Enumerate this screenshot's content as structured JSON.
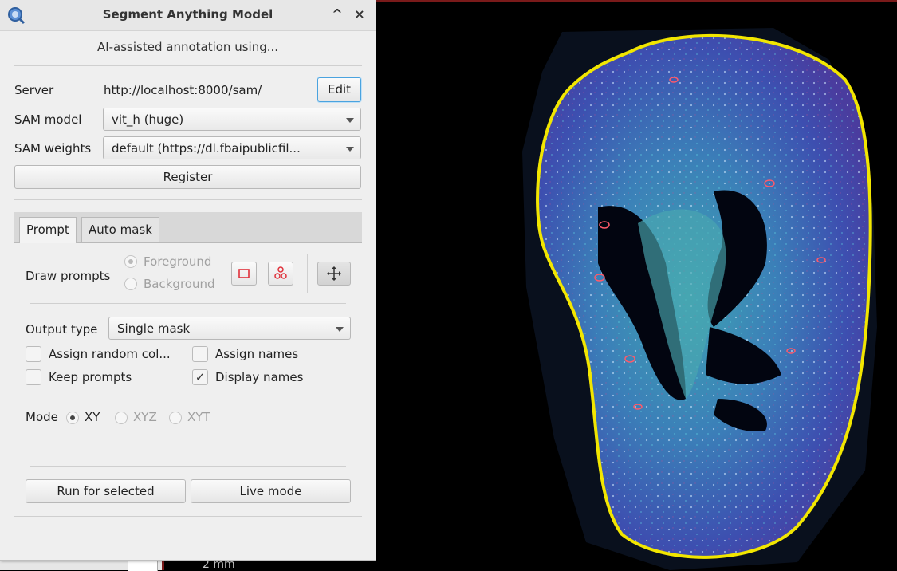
{
  "window": {
    "title": "Segment Anything Model",
    "subtitle": "AI-assisted annotation using...",
    "minimize_glyph": "^",
    "close_glyph": "×"
  },
  "server": {
    "label": "Server",
    "url": "http://localhost:8000/sam/",
    "edit_label": "Edit"
  },
  "sam_model": {
    "label": "SAM model",
    "selected": "vit_h (huge)"
  },
  "sam_weights": {
    "label": "SAM weights",
    "selected": "default (https://dl.fbaipublicfil..."
  },
  "register_label": "Register",
  "tabs": [
    {
      "label": "Prompt",
      "active": true
    },
    {
      "label": "Auto mask",
      "active": false
    }
  ],
  "draw_prompts": {
    "label": "Draw prompts",
    "foreground_label": "Foreground",
    "background_label": "Background",
    "selected": "Foreground"
  },
  "output_type": {
    "label": "Output type",
    "selected": "Single mask"
  },
  "options": {
    "assign_random_colors": {
      "label": "Assign random col...",
      "checked": false
    },
    "assign_names": {
      "label": "Assign names",
      "checked": false
    },
    "keep_prompts": {
      "label": "Keep prompts",
      "checked": false
    },
    "display_names": {
      "label": "Display names",
      "checked": true
    }
  },
  "mode": {
    "label": "Mode",
    "options": [
      "XY",
      "XYZ",
      "XYT"
    ],
    "selected": "XY"
  },
  "actions": {
    "run_selected_label": "Run for selected",
    "live_mode_label": "Live mode"
  },
  "viewer": {
    "scalebar_text": "2 mm"
  },
  "colors": {
    "annotation_outline": "#f2e600",
    "accent": "#4aa3df",
    "tool_red": "#e0303a"
  },
  "icons": [
    "app-logo-icon",
    "rectangle-tool-icon",
    "points-tool-icon",
    "move-tool-icon",
    "chevron-up-icon",
    "close-icon"
  ]
}
